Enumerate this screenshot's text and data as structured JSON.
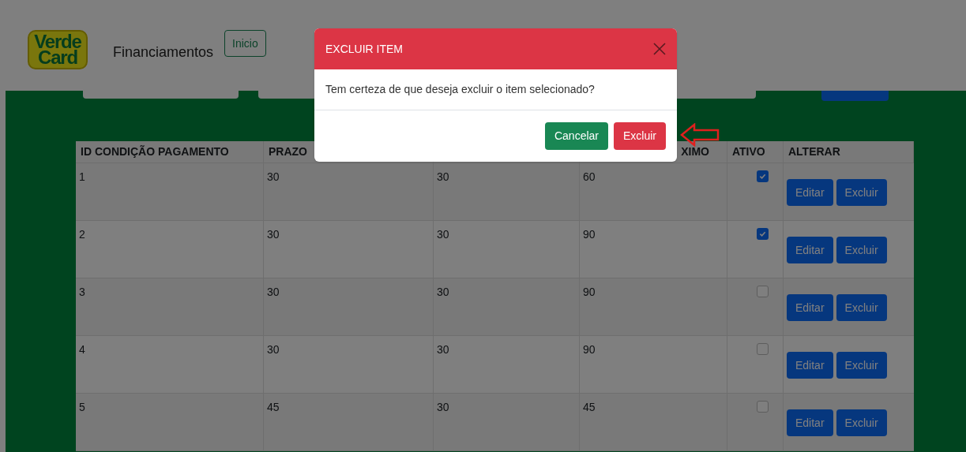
{
  "header": {
    "logo": {
      "line_1": "Verde",
      "line_2": "Card"
    },
    "title": "Financiamentos",
    "home_button": "Inicio"
  },
  "table": {
    "headers": {
      "id": "ID CONDIÇÃO PAGAMENTO",
      "column_2": "PRAZO",
      "column_4": "XIMO",
      "active": "ATIVO",
      "actions": "ALTERAR"
    },
    "rows": [
      {
        "id": "1",
        "column_2": "30",
        "column_3": "30",
        "column_4": "60",
        "active": true,
        "edit": "Editar",
        "delete": "Excluir"
      },
      {
        "id": "2",
        "column_2": "30",
        "column_3": "30",
        "column_4": "90",
        "active": true,
        "edit": "Editar",
        "delete": "Excluir"
      },
      {
        "id": "3",
        "column_2": "30",
        "column_3": "30",
        "column_4": "90",
        "active": false,
        "edit": "Editar",
        "delete": "Excluir"
      },
      {
        "id": "4",
        "column_2": "30",
        "column_3": "30",
        "column_4": "90",
        "active": false,
        "edit": "Editar",
        "delete": "Excluir"
      },
      {
        "id": "5",
        "column_2": "45",
        "column_3": "30",
        "column_4": "45",
        "active": false,
        "edit": "Editar",
        "delete": "Excluir"
      }
    ]
  },
  "modal": {
    "title": "EXCLUIR ITEM",
    "message": "Tem certeza de que deseja excluir o item selecionado?",
    "buttons": [
      {
        "label": "Cancelar",
        "kind": "cancel"
      },
      {
        "label": "Excluir",
        "kind": "danger"
      }
    ]
  }
}
